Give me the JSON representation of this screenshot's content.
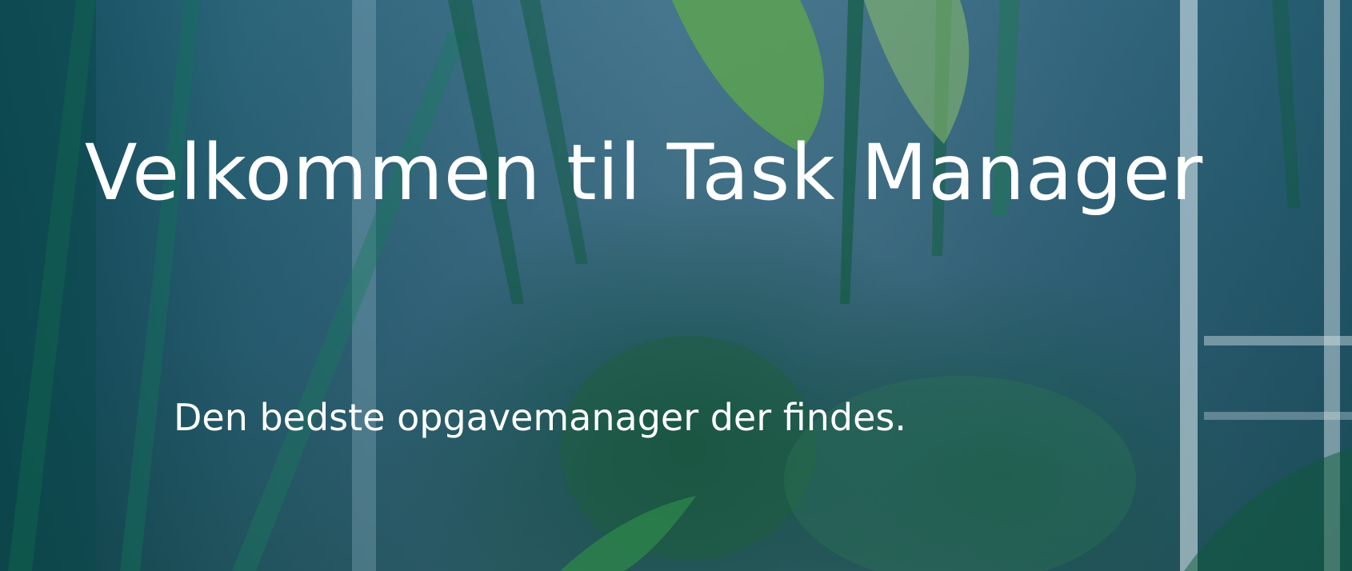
{
  "hero": {
    "title": "Velkommen til Task Manager",
    "subtitle": "Den bedste opgavemanager der findes.",
    "background_image": "plants-photo",
    "text_color": "#ffffff",
    "overlay_color": "#14465f"
  }
}
